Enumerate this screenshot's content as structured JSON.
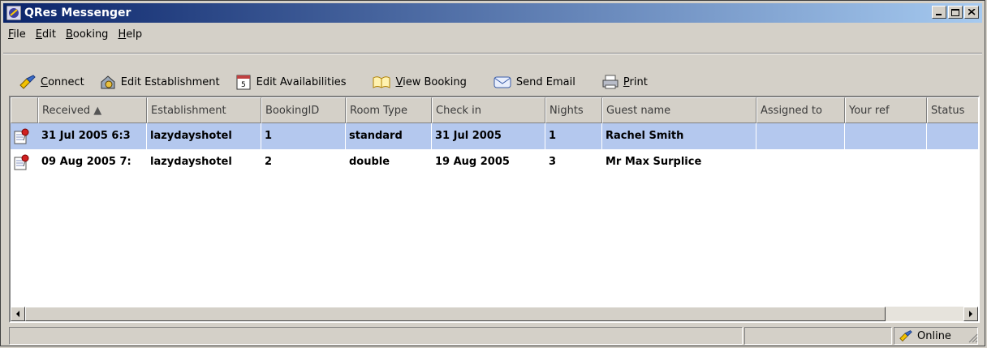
{
  "window": {
    "title": "QRes Messenger"
  },
  "menu": [
    {
      "label": "File",
      "key": "F",
      "rest": "ile"
    },
    {
      "label": "Edit",
      "key": "E",
      "rest": "dit"
    },
    {
      "label": "Booking",
      "key": "B",
      "rest": "ooking"
    },
    {
      "label": "Help",
      "key": "H",
      "rest": "elp"
    }
  ],
  "toolbar": {
    "connect": {
      "key": "C",
      "rest": "onnect",
      "icon": "connect-icon"
    },
    "edit_establishment": "Edit Establishment",
    "edit_availabilities": "Edit Availabilities",
    "view_booking": {
      "key": "V",
      "rest": "iew Booking"
    },
    "send_email": "Send Email",
    "print": {
      "key": "P",
      "rest": "rint"
    }
  },
  "table": {
    "sort_indicator": "▲",
    "columns": [
      "Received",
      "Establishment",
      "BookingID",
      "Room Type",
      "Check in",
      "Nights",
      "Guest name",
      "Assigned to",
      "Your ref",
      "Status"
    ],
    "rows": [
      {
        "received": "31 Jul 2005 6:3",
        "establishment": "lazydayshotel",
        "booking_id": "1",
        "room_type": "standard",
        "check_in": "31 Jul 2005",
        "nights": "1",
        "guest_name": "Rachel Smith",
        "assigned_to": "",
        "your_ref": "",
        "status": "",
        "selected": true
      },
      {
        "received": "09 Aug 2005 7:",
        "establishment": "lazydayshotel",
        "booking_id": "2",
        "room_type": "double",
        "check_in": "19 Aug 2005",
        "nights": "3",
        "guest_name": "Mr Max Surplice",
        "assigned_to": "",
        "your_ref": "",
        "status": "",
        "selected": false
      }
    ]
  },
  "status": {
    "connection": "Online"
  },
  "colors": {
    "title_start": "#0a246a",
    "title_end": "#a6caf0",
    "selected_row": "#b4c8ee"
  }
}
